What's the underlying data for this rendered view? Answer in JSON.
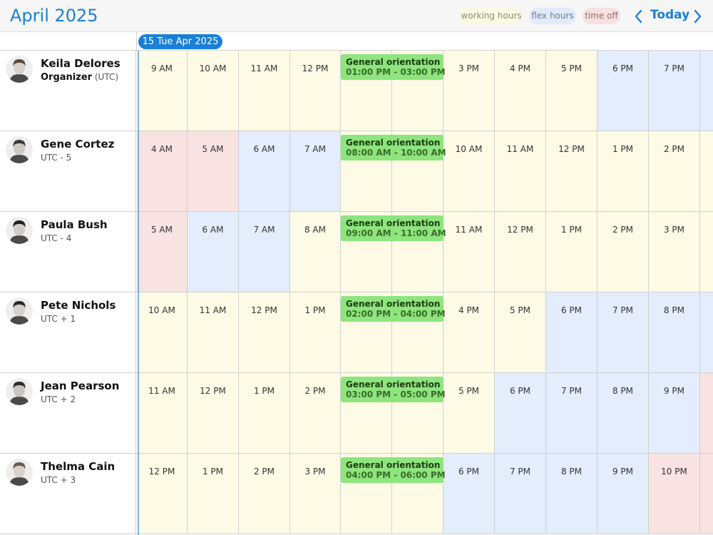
{
  "header": {
    "title": "April 2025",
    "legend": {
      "working": "working hours",
      "flex": "flex hours",
      "off": "time off"
    },
    "today_label": "Today",
    "icons": {
      "prev": "chevron-left-icon",
      "next": "chevron-right-icon"
    }
  },
  "date_chip": "15 Tue Apr 2025",
  "colors": {
    "accent": "#1a7fd6",
    "working": "#fdfbe6",
    "flex": "#e3edfb",
    "off": "#f9e2e2",
    "event": "#8ee57e"
  },
  "people": [
    {
      "name": "Keila Delores",
      "role": "Organizer",
      "timezone": "(UTC)",
      "event": {
        "title": "General orientation",
        "time": "01:00 PM - 03:00 PM"
      },
      "slots": [
        {
          "label": "9 AM",
          "kind": "working"
        },
        {
          "label": "10 AM",
          "kind": "working"
        },
        {
          "label": "11 AM",
          "kind": "working"
        },
        {
          "label": "12 PM",
          "kind": "working"
        },
        {
          "label": "",
          "kind": "working"
        },
        {
          "label": "",
          "kind": "working"
        },
        {
          "label": "3 PM",
          "kind": "working"
        },
        {
          "label": "4 PM",
          "kind": "working"
        },
        {
          "label": "5 PM",
          "kind": "working"
        },
        {
          "label": "6 PM",
          "kind": "flex"
        },
        {
          "label": "7 PM",
          "kind": "flex"
        },
        {
          "label": "",
          "kind": "flex"
        }
      ]
    },
    {
      "name": "Gene Cortez",
      "role": "",
      "timezone": "UTC - 5",
      "event": {
        "title": "General orientation",
        "time": "08:00 AM - 10:00 AM"
      },
      "slots": [
        {
          "label": "4 AM",
          "kind": "off"
        },
        {
          "label": "5 AM",
          "kind": "off"
        },
        {
          "label": "6 AM",
          "kind": "flex"
        },
        {
          "label": "7 AM",
          "kind": "flex"
        },
        {
          "label": "",
          "kind": "working"
        },
        {
          "label": "",
          "kind": "working"
        },
        {
          "label": "10 AM",
          "kind": "working"
        },
        {
          "label": "11 AM",
          "kind": "working"
        },
        {
          "label": "12 PM",
          "kind": "working"
        },
        {
          "label": "1 PM",
          "kind": "working"
        },
        {
          "label": "2 PM",
          "kind": "working"
        },
        {
          "label": "",
          "kind": "working"
        }
      ]
    },
    {
      "name": "Paula Bush",
      "role": "",
      "timezone": "UTC - 4",
      "event": {
        "title": "General orientation",
        "time": "09:00 AM - 11:00 AM"
      },
      "slots": [
        {
          "label": "5 AM",
          "kind": "off"
        },
        {
          "label": "6 AM",
          "kind": "flex"
        },
        {
          "label": "7 AM",
          "kind": "flex"
        },
        {
          "label": "8 AM",
          "kind": "working"
        },
        {
          "label": "",
          "kind": "working"
        },
        {
          "label": "",
          "kind": "working"
        },
        {
          "label": "11 AM",
          "kind": "working"
        },
        {
          "label": "12 PM",
          "kind": "working"
        },
        {
          "label": "1 PM",
          "kind": "working"
        },
        {
          "label": "2 PM",
          "kind": "working"
        },
        {
          "label": "3 PM",
          "kind": "working"
        },
        {
          "label": "",
          "kind": "working"
        }
      ]
    },
    {
      "name": "Pete Nichols",
      "role": "",
      "timezone": "UTC + 1",
      "event": {
        "title": "General orientation",
        "time": "02:00 PM - 04:00 PM"
      },
      "slots": [
        {
          "label": "10 AM",
          "kind": "working"
        },
        {
          "label": "11 AM",
          "kind": "working"
        },
        {
          "label": "12 PM",
          "kind": "working"
        },
        {
          "label": "1 PM",
          "kind": "working"
        },
        {
          "label": "",
          "kind": "working"
        },
        {
          "label": "",
          "kind": "working"
        },
        {
          "label": "4 PM",
          "kind": "working"
        },
        {
          "label": "5 PM",
          "kind": "working"
        },
        {
          "label": "6 PM",
          "kind": "flex"
        },
        {
          "label": "7 PM",
          "kind": "flex"
        },
        {
          "label": "8 PM",
          "kind": "flex"
        },
        {
          "label": "",
          "kind": "flex"
        }
      ]
    },
    {
      "name": "Jean Pearson",
      "role": "",
      "timezone": "UTC + 2",
      "event": {
        "title": "General orientation",
        "time": "03:00 PM - 05:00 PM"
      },
      "slots": [
        {
          "label": "11 AM",
          "kind": "working"
        },
        {
          "label": "12 PM",
          "kind": "working"
        },
        {
          "label": "1 PM",
          "kind": "working"
        },
        {
          "label": "2 PM",
          "kind": "working"
        },
        {
          "label": "",
          "kind": "working"
        },
        {
          "label": "",
          "kind": "working"
        },
        {
          "label": "5 PM",
          "kind": "working"
        },
        {
          "label": "6 PM",
          "kind": "flex"
        },
        {
          "label": "7 PM",
          "kind": "flex"
        },
        {
          "label": "8 PM",
          "kind": "flex"
        },
        {
          "label": "9 PM",
          "kind": "flex"
        },
        {
          "label": "",
          "kind": "off"
        }
      ]
    },
    {
      "name": "Thelma Cain",
      "role": "",
      "timezone": "UTC + 3",
      "event": {
        "title": "General orientation",
        "time": "04:00 PM - 06:00 PM"
      },
      "slots": [
        {
          "label": "12 PM",
          "kind": "working"
        },
        {
          "label": "1 PM",
          "kind": "working"
        },
        {
          "label": "2 PM",
          "kind": "working"
        },
        {
          "label": "3 PM",
          "kind": "working"
        },
        {
          "label": "",
          "kind": "working"
        },
        {
          "label": "",
          "kind": "working"
        },
        {
          "label": "6 PM",
          "kind": "flex"
        },
        {
          "label": "7 PM",
          "kind": "flex"
        },
        {
          "label": "8 PM",
          "kind": "flex"
        },
        {
          "label": "9 PM",
          "kind": "flex"
        },
        {
          "label": "10 PM",
          "kind": "off"
        },
        {
          "label": "",
          "kind": "off"
        }
      ]
    }
  ]
}
